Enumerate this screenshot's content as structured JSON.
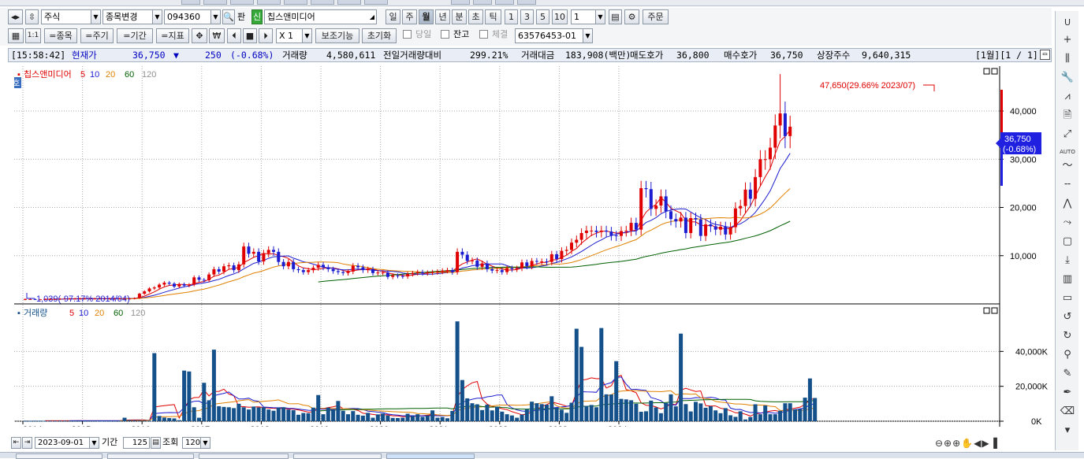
{
  "toolbar1": {
    "market": "주식",
    "change_label": "종목변경",
    "code": "094360",
    "pan": "판",
    "sin": "신",
    "name": "칩스앤미디어",
    "periods": [
      "일",
      "주",
      "월",
      "년",
      "분",
      "초",
      "틱"
    ],
    "active_period": "월",
    "mins": [
      "1",
      "3",
      "5",
      "10"
    ],
    "interval": "1",
    "order": "주문"
  },
  "toolbar2": {
    "t11": "1:1",
    "item": "=종목",
    "cycle": "=주기",
    "range": "=기간",
    "index": "=지표",
    "won": "₩",
    "xval": "X 1",
    "aux": "보조기능",
    "reset": "초기화",
    "day_label": "당일",
    "balance_label": "잔고",
    "exec_label": "체결",
    "account": "63576453-01"
  },
  "status": {
    "time": "[15:58:42]",
    "price_label": "현재가",
    "price": "36,750",
    "arrow": "▼",
    "change": "250",
    "change_pct": "(-0.68%)",
    "volume_label": "거래량",
    "volume": "4,580,611",
    "prevvol_label": "전일거래량대비",
    "prevvol": "299.21%",
    "amount_label": "거래대금",
    "amount": "183,908(백만)",
    "ask_label": "매도호가",
    "ask": "36,800",
    "bid_label": "매수호가",
    "bid": "36,750",
    "shares_label": "상장주수",
    "shares": "9,640,315",
    "page": "[1월][1 / 1]"
  },
  "chart_data": [
    {
      "type": "candlestick",
      "title": "칩스앤미디어",
      "period": "monthly",
      "legend": [
        {
          "name": "칩스앤미디어",
          "color": "#e00000"
        },
        {
          "name": "5",
          "color": "#e00000"
        },
        {
          "name": "10",
          "color": "#1c1cd0"
        },
        {
          "name": "20",
          "color": "#e08000"
        },
        {
          "name": "60",
          "color": "#006000"
        },
        {
          "name": "120",
          "color": "#909090"
        }
      ],
      "ylim": [
        0,
        48000
      ],
      "yticks": [
        "10,000",
        "20,000",
        "30,000",
        "40,000"
      ],
      "max_annotation": "47,650(29.66% 2023/07)",
      "min_annotation": "1,039(-97.17% 2014/04)",
      "last_price": "36,750",
      "last_change": "(-0.68%)",
      "o": [
        900,
        1000,
        1000,
        950,
        950,
        980,
        1000,
        1000,
        1050,
        1100,
        1100,
        1100,
        1100,
        1100,
        1100,
        1100,
        1100,
        1100,
        1100,
        1100,
        1100,
        1100,
        1100,
        1200,
        2100,
        2600,
        3200,
        3400,
        4000,
        4400,
        4200,
        3600,
        4100,
        3800,
        4000,
        5500,
        5000,
        4900,
        6100,
        7200,
        6700,
        7800,
        8000,
        7000,
        8200,
        11900,
        10400,
        10800,
        8800,
        10500,
        11200,
        10800,
        8700,
        7800,
        8700,
        7200,
        7000,
        6600,
        7000,
        7500,
        8100,
        7600,
        7200,
        6800,
        6600,
        6400,
        6700,
        7900,
        7600,
        7000,
        7200,
        6400,
        6500,
        6500,
        5600,
        5900,
        5800,
        5700,
        6200,
        6400,
        6600,
        6400,
        6500,
        6600,
        6700,
        6900,
        7000,
        6600,
        10800,
        10200,
        8900,
        9000,
        7700,
        8400,
        7200,
        6900,
        7000,
        6600,
        7400,
        7200,
        7400,
        8600,
        7800,
        8900,
        8800,
        8800,
        8700,
        10300,
        9300,
        11000,
        11200,
        12700,
        13300,
        14700,
        15200,
        15200,
        14900,
        15200,
        15000,
        14200,
        14100,
        15100,
        15200,
        16800,
        15400,
        24000,
        23800,
        19700,
        20400,
        22300,
        19200,
        17600,
        17100,
        17900,
        14700,
        17800,
        17500,
        14100,
        16500,
        16100,
        15400,
        16000,
        14400,
        15900,
        19800,
        20300,
        23700,
        21800,
        26300,
        30000,
        30000,
        32400,
        37000,
        39500,
        34800
      ]
    },
    {
      "type": "bar",
      "title": "거래량",
      "legend": [
        {
          "name": "거래량",
          "color": "#14508a"
        },
        {
          "name": "5",
          "color": "#e00000"
        },
        {
          "name": "10",
          "color": "#1c1cd0"
        },
        {
          "name": "20",
          "color": "#e08000"
        },
        {
          "name": "60",
          "color": "#006000"
        },
        {
          "name": "120",
          "color": "#909090"
        }
      ],
      "ylim": [
        0,
        60000
      ],
      "yticks": [
        "0K",
        "20,000K",
        "40,000K"
      ],
      "values": [
        300,
        250,
        300,
        300,
        250,
        250,
        250,
        300,
        300,
        300,
        300,
        300,
        250,
        300,
        300,
        250,
        250,
        250,
        300,
        300,
        2000,
        500,
        400,
        300,
        300,
        300,
        39000,
        3000,
        2100,
        1800,
        1600,
        600,
        29000,
        28500,
        8000,
        2000,
        22000,
        12000,
        41000,
        8600,
        8200,
        8000,
        7500,
        10000,
        8000,
        6700,
        8400,
        7900,
        8000,
        6700,
        6000,
        7800,
        8000,
        6700,
        6300,
        3700,
        4700,
        4600,
        7800,
        15000,
        4000,
        7800,
        6700,
        11600,
        6000,
        4000,
        5800,
        3700,
        3200,
        4800,
        2000,
        3900,
        4400,
        3300,
        1900,
        1800,
        2000,
        4300,
        3000,
        4000,
        2500,
        3300,
        6200,
        2000,
        2400,
        1700,
        5900,
        57200,
        23600,
        13100,
        10300,
        9700,
        6400,
        9500,
        6200,
        8200,
        5500,
        4000,
        3300,
        2000,
        3800,
        6900,
        11200,
        10300,
        9800,
        9500,
        14300,
        7700,
        6600,
        4800,
        10600,
        53000,
        42600,
        8800,
        9300,
        8000,
        53400,
        15400,
        15300,
        34400,
        12800,
        12500,
        12000,
        10000,
        5400,
        5700,
        11800,
        7900,
        4600,
        10500,
        15400,
        8500,
        50200,
        9800,
        5600,
        11100,
        10200,
        7700,
        8600,
        6200,
        4600,
        7500,
        3400,
        2500,
        5700,
        1000,
        2400,
        9700,
        4000,
        9000,
        4000,
        4000,
        6000,
        10300,
        10300,
        6800,
        7000,
        13500,
        24500,
        13300
      ]
    },
    {
      "type": "axis",
      "categories": [
        "2014",
        "2015",
        "2016",
        "2017",
        "2018",
        "2019",
        "2020",
        "2021",
        "2022",
        "2023",
        "2024"
      ]
    }
  ],
  "bottom": {
    "date": "2023-09-01",
    "period_label": "기간",
    "period_value": "125",
    "query_label": "조회",
    "count": "120"
  },
  "colors": {
    "up": "#e00000",
    "down": "#1c1cd0",
    "volume": "#14508a",
    "ma5": "#e00000",
    "ma10": "#1c1cd0",
    "ma20": "#e08000",
    "ma60": "#006000",
    "ma120": "#909090"
  }
}
